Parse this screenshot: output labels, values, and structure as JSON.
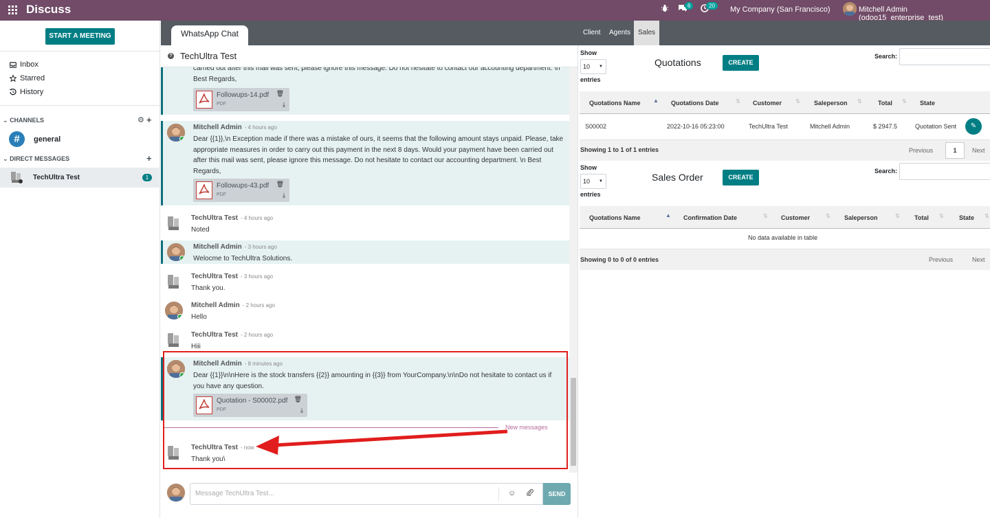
{
  "topbar": {
    "app_title": "Discuss",
    "chat_badge": "6",
    "activity_badge": "20",
    "company": "My Company (San Francisco)",
    "user": "Mitchell Admin (odoo15_enterprise_test)"
  },
  "sidebar": {
    "start_meeting": "START A MEETING",
    "mailboxes": [
      {
        "label": "Inbox",
        "icon": "inbox-icon"
      },
      {
        "label": "Starred",
        "icon": "star-icon"
      },
      {
        "label": "History",
        "icon": "history-icon"
      }
    ],
    "channels_header": "CHANNELS",
    "channel": "general",
    "dm_header": "DIRECT MESSAGES",
    "dm_name": "TechUltra Test",
    "dm_count": "1"
  },
  "chat": {
    "tab": "WhatsApp Chat",
    "thread_title": "TechUltra Test",
    "new_messages": "New messages",
    "composer_placeholder": "Message TechUltra Test...",
    "send": "SEND",
    "messages": [
      {
        "body": "carried out after this mail was sent, please ignore this message. Do not hesitate to contact our accounting department. \\n Best Regards,",
        "attachment": {
          "name": "Followups-14.pdf",
          "type": "PDF"
        }
      },
      {
        "author": "Mitchell Admin",
        "time": "- 4 hours ago",
        "body": "Dear {{1}},\\n Exception made if there was a mistake of ours, it seems that the following amount stays unpaid. Please, take appropriate measures in order to carry out this payment in the next 8 days. Would your payment have been carried out after this mail was sent, please ignore this message. Do not hesitate to contact our accounting department. \\n Best Regards,",
        "attachment": {
          "name": "Followups-43.pdf",
          "type": "PDF"
        }
      },
      {
        "author": "TechUltra Test",
        "time": "- 4 hours ago",
        "body": "Noted"
      },
      {
        "author": "Mitchell Admin",
        "time": "- 3 hours ago",
        "body": "Welocme to TechUltra Solutions."
      },
      {
        "author": "TechUltra Test",
        "time": "- 3 hours ago",
        "body": "Thank you."
      },
      {
        "author": "Mitchell Admin",
        "time": "- 2 hours ago",
        "body": "Hello"
      },
      {
        "author": "TechUltra Test",
        "time": "- 2 hours ago",
        "body": "Hiii"
      },
      {
        "author": "Mitchell Admin",
        "time": "- 8 minutes ago",
        "body": "Dear {{1}}\\n\\nHere is the stock transfers {{2}} amounting in {{3}} from YourCompany.\\n\\nDo not hesitate to contact us if you have any question.",
        "attachment": {
          "name": "Quotation - S00002.pdf",
          "type": "PDF"
        }
      },
      {
        "author": "TechUltra Test",
        "time": "- now",
        "body": "Thank you\\"
      }
    ]
  },
  "right": {
    "tabs": [
      "Client",
      "Agents",
      "Sales"
    ],
    "quotations": {
      "show": "Show",
      "entries_value": "10",
      "entries": "entries",
      "title": "Quotations",
      "create": "CREATE",
      "search": "Search:",
      "columns": [
        "Quotations Name",
        "Quotations Date",
        "Customer",
        "Saleperson",
        "Total",
        "State"
      ],
      "row": [
        "S00002",
        "2022-10-16 05:23:00",
        "TechUltra Test",
        "Mitchell Admin",
        "$ 2947.5",
        "Quotation Sent"
      ],
      "info": "Showing 1 to 1 of 1 entries",
      "previous": "Previous",
      "page": "1",
      "next": "Next"
    },
    "sales_order": {
      "show": "Show",
      "entries_value": "10",
      "entries": "entries",
      "title": "Sales Order",
      "create": "CREATE",
      "search": "Search:",
      "columns": [
        "Quotations Name",
        "Confirmation Date",
        "Customer",
        "Saleperson",
        "Total",
        "State"
      ],
      "empty": "No data available in table",
      "info": "Showing 0 to 0 of 0 entries",
      "previous": "Previous",
      "next": "Next"
    }
  }
}
